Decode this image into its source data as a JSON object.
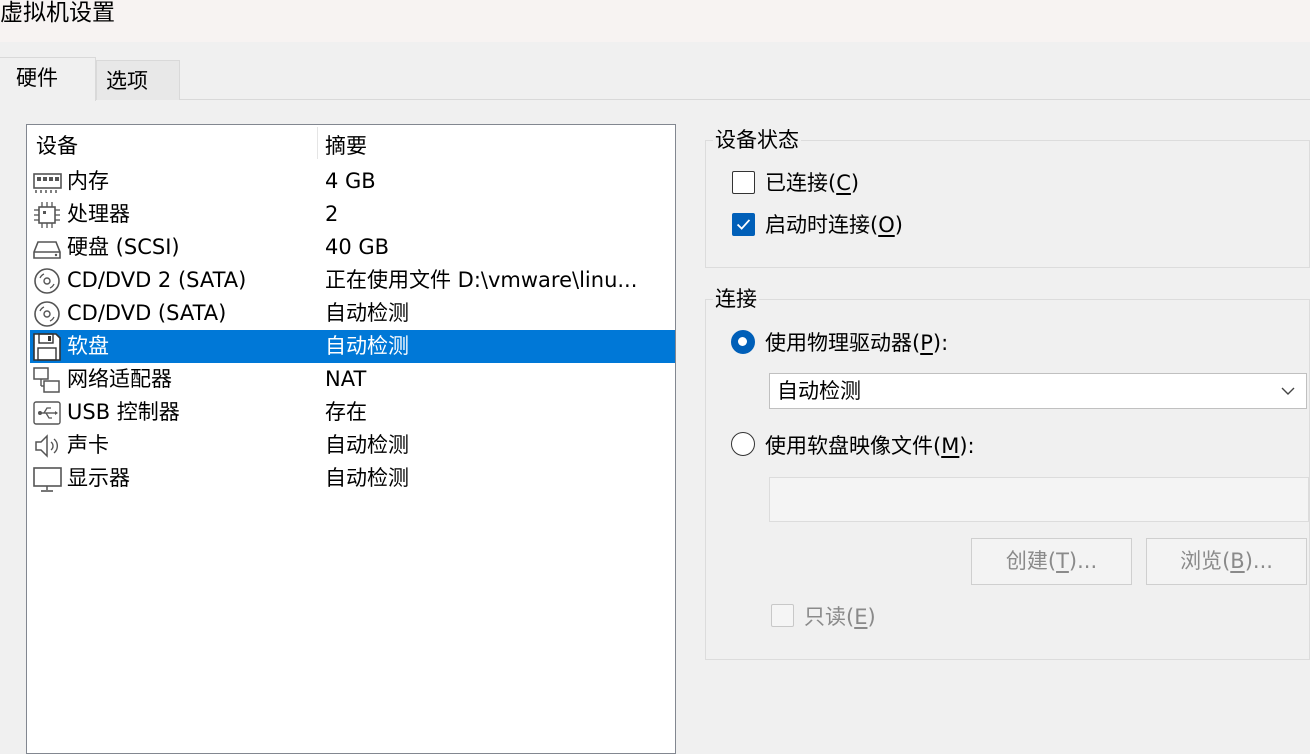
{
  "window": {
    "title": "虚拟机设置"
  },
  "tabs": [
    {
      "label": "硬件",
      "active": true
    },
    {
      "label": "选项",
      "active": false
    }
  ],
  "device_list": {
    "columns": [
      "设备",
      "摘要"
    ],
    "rows": [
      {
        "icon": "memory-icon",
        "name": "内存",
        "summary": "4 GB"
      },
      {
        "icon": "processor-icon",
        "name": "处理器",
        "summary": "2"
      },
      {
        "icon": "hard-disk-icon",
        "name": "硬盘 (SCSI)",
        "summary": "40 GB"
      },
      {
        "icon": "cd-dvd-icon",
        "name": "CD/DVD 2 (SATA)",
        "summary": "正在使用文件 D:\\vmware\\linu..."
      },
      {
        "icon": "cd-dvd-icon",
        "name": "CD/DVD (SATA)",
        "summary": "自动检测"
      },
      {
        "icon": "floppy-icon",
        "name": "软盘",
        "summary": "自动检测",
        "selected": true
      },
      {
        "icon": "network-adapter-icon",
        "name": "网络适配器",
        "summary": "NAT"
      },
      {
        "icon": "usb-icon",
        "name": "USB 控制器",
        "summary": "存在"
      },
      {
        "icon": "speaker-icon",
        "name": "声卡",
        "summary": "自动检测"
      },
      {
        "icon": "monitor-icon",
        "name": "显示器",
        "summary": "自动检测"
      }
    ]
  },
  "device_status": {
    "label": "设备状态",
    "connected": {
      "text": "已连接",
      "mnemonic": "C",
      "checked": false
    },
    "connect_at_power_on": {
      "text": "启动时连接",
      "mnemonic": "O",
      "checked": true
    }
  },
  "connection": {
    "label": "连接",
    "use_physical_drive": {
      "text": "使用物理驱动器",
      "mnemonic": "P",
      "suffix": ":",
      "selected": true
    },
    "drive_select": {
      "value": "自动检测"
    },
    "use_floppy_image": {
      "text": "使用软盘映像文件",
      "mnemonic": "M",
      "suffix": ":",
      "selected": false
    },
    "image_path": {
      "value": ""
    },
    "create_button": {
      "text": "创建",
      "mnemonic": "T",
      "suffix": "..."
    },
    "browse_button": {
      "text": "浏览",
      "mnemonic": "B",
      "suffix": "..."
    },
    "read_only": {
      "text": "只读",
      "mnemonic": "E",
      "checked": false,
      "enabled": false
    }
  },
  "colors": {
    "selection": "#0078d7",
    "accent": "#005fb8"
  }
}
